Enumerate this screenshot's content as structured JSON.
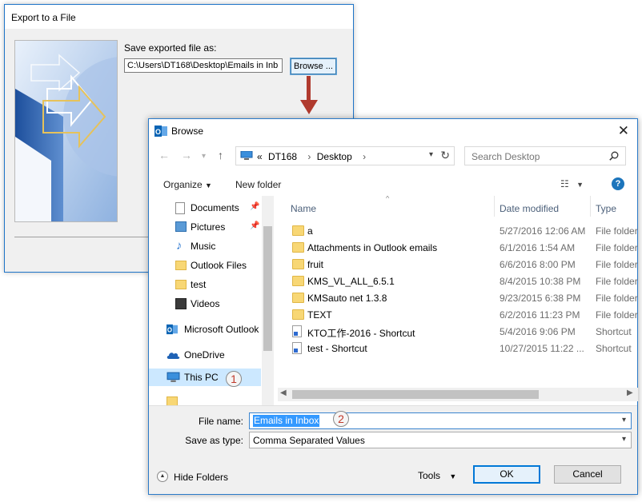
{
  "export_dialog": {
    "title": "Export to a File",
    "save_label": "Save exported file as:",
    "path_value": "C:\\Users\\DT168\\Desktop\\Emails in Inb",
    "browse_label": "Browse ..."
  },
  "browse_dialog": {
    "title": "Browse",
    "address": {
      "prefix": "«",
      "crumbs": [
        "DT168",
        "Desktop"
      ]
    },
    "search_placeholder": "Search Desktop",
    "toolbar": {
      "organize": "Organize",
      "new_folder": "New folder",
      "help": "?"
    },
    "nav_items": [
      {
        "label": "Documents",
        "icon": "documents-icon",
        "pinned": true
      },
      {
        "label": "Pictures",
        "icon": "pictures-icon",
        "pinned": true
      },
      {
        "label": "Music",
        "icon": "music-icon",
        "pinned": false
      },
      {
        "label": "Outlook Files",
        "icon": "folder-icon",
        "pinned": false
      },
      {
        "label": "test",
        "icon": "folder-icon",
        "pinned": false
      },
      {
        "label": "Videos",
        "icon": "videos-icon",
        "pinned": false
      },
      {
        "label": "Microsoft Outlook",
        "icon": "outlook-icon",
        "pinned": false
      },
      {
        "label": "OneDrive",
        "icon": "onedrive-icon",
        "pinned": false
      },
      {
        "label": "This PC",
        "icon": "computer-icon",
        "pinned": false,
        "selected": true
      }
    ],
    "columns": {
      "name": "Name",
      "date": "Date modified",
      "type": "Type"
    },
    "files": [
      {
        "name": "a",
        "date": "5/27/2016 12:06 AM",
        "type": "File folder",
        "kind": "folder"
      },
      {
        "name": "Attachments in Outlook emails",
        "date": "6/1/2016 1:54 AM",
        "type": "File folder",
        "kind": "folder"
      },
      {
        "name": "fruit",
        "date": "6/6/2016 8:00 PM",
        "type": "File folder",
        "kind": "folder"
      },
      {
        "name": "KMS_VL_ALL_6.5.1",
        "date": "8/4/2015 10:38 PM",
        "type": "File folder",
        "kind": "folder"
      },
      {
        "name": "KMSauto net 1.3.8",
        "date": "9/23/2015 6:38 PM",
        "type": "File folder",
        "kind": "folder"
      },
      {
        "name": "TEXT",
        "date": "6/2/2016 11:23 PM",
        "type": "File folder",
        "kind": "folder"
      },
      {
        "name": "KTO工作-2016 - Shortcut",
        "date": "5/4/2016 9:06 PM",
        "type": "Shortcut",
        "kind": "shortcut"
      },
      {
        "name": "test - Shortcut",
        "date": "10/27/2015 11:22 ...",
        "type": "Shortcut",
        "kind": "shortcut"
      }
    ],
    "file_name_label": "File name:",
    "file_name_value": "Emails in Inbox",
    "save_type_label": "Save as type:",
    "save_type_value": "Comma Separated Values",
    "hide_folders": "Hide Folders",
    "tools": "Tools",
    "ok": "OK",
    "cancel": "Cancel",
    "step_badges": [
      "1",
      "2"
    ]
  },
  "colors": {
    "accent": "#0078d7",
    "arrow": "#b03a2e",
    "selection": "#3399ff",
    "nav_selected": "#cce8ff"
  }
}
